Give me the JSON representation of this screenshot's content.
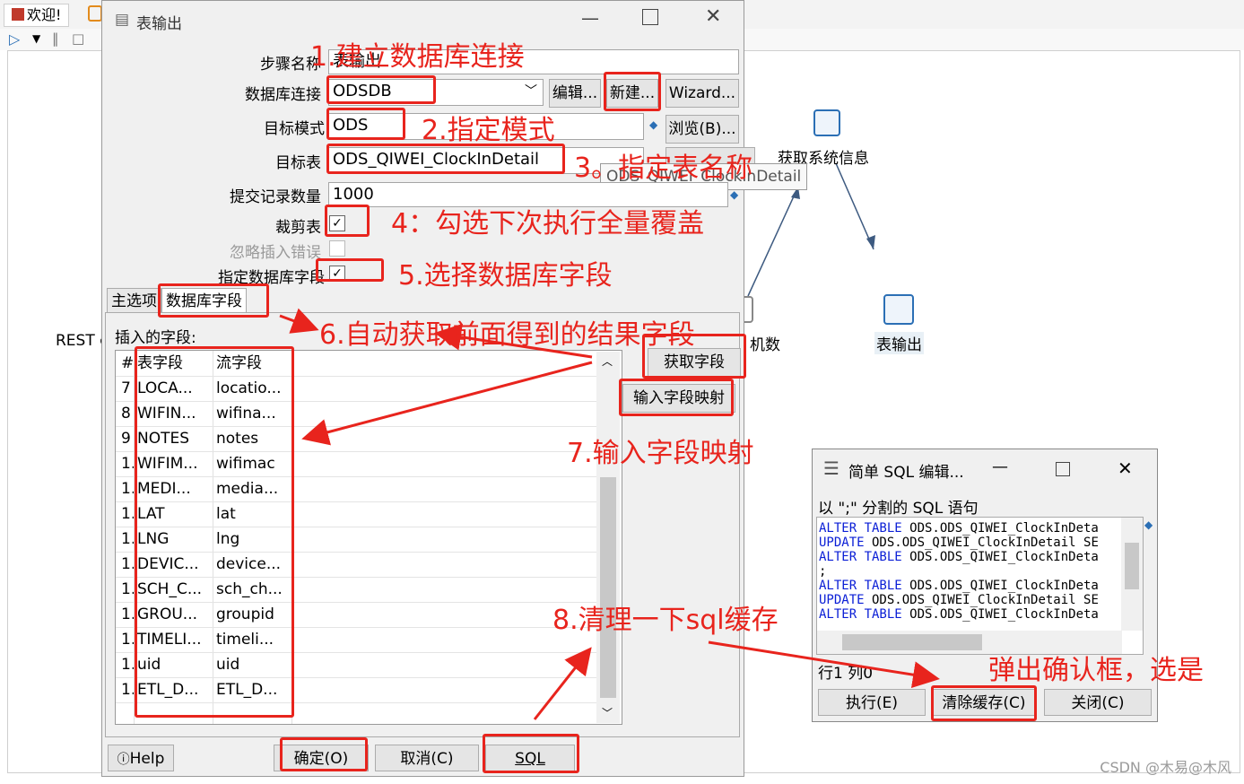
{
  "app": {
    "tab_welcome": "欢迎!",
    "canvas_nodes": {
      "get_system_info": "获取系统信息",
      "table_output": "表输出",
      "rest_partial": "REST c",
      "machine_partial": "机数"
    }
  },
  "dialog": {
    "title": "表输出",
    "step_name_label": "步骤名称",
    "step_name_value": "表输出",
    "db_conn_label": "数据库连接",
    "db_conn_value": "ODSDB",
    "edit_button": "编辑...",
    "new_button": "新建...",
    "wizard_button": "Wizard...",
    "schema_label": "目标模式",
    "schema_value": "ODS",
    "browse_button": "浏览(B)...",
    "target_table_label": "目标表",
    "target_table_value": "ODS_QIWEI_ClockInDetail",
    "tooltip_value": "ODS_QIWEI_ClockInDetail",
    "commit_size_label": "提交记录数量",
    "commit_size_value": "1000",
    "truncate_label": "裁剪表",
    "ignore_errors_label": "忽略插入错误",
    "specify_fields_label": "指定数据库字段",
    "tab_main": "主选项",
    "tab_db_fields": "数据库字段",
    "inserted_fields_label": "插入的字段:",
    "get_fields_button": "获取字段",
    "field_mapping_button": "输入字段映射",
    "help_button": "Help",
    "ok_button": "确定(O)",
    "cancel_button": "取消(C)",
    "sql_button": "SQL"
  },
  "fields_table": {
    "headers": [
      "#",
      "表字段",
      "流字段"
    ],
    "rows": [
      [
        "7",
        "LOCA...",
        "locatio..."
      ],
      [
        "8",
        "WIFIN...",
        "wifina..."
      ],
      [
        "9",
        "NOTES",
        "notes"
      ],
      [
        "1.",
        "WIFIM...",
        "wifimac"
      ],
      [
        "1.",
        "MEDI...",
        "media..."
      ],
      [
        "1.",
        "LAT",
        "lat"
      ],
      [
        "1.",
        "LNG",
        "lng"
      ],
      [
        "1.",
        "DEVIC...",
        "device..."
      ],
      [
        "1.",
        "SCH_C...",
        "sch_ch..."
      ],
      [
        "1.",
        "GROU...",
        "groupid"
      ],
      [
        "1.",
        "TIMELI...",
        "timeli..."
      ],
      [
        "1.",
        "uid",
        "uid"
      ],
      [
        "1.",
        "ETL_D...",
        "ETL_D..."
      ]
    ]
  },
  "sql_dialog": {
    "title": "简单 SQL 编辑...",
    "desc": "以 \";\" 分割的 SQL 语句",
    "lines": [
      {
        "kw": "ALTER TABLE",
        "rest": " ODS.ODS_QIWEI_ClockInDeta"
      },
      {
        "kw": "UPDATE",
        "rest": " ODS.ODS_QIWEI_ClockInDetail SE"
      },
      {
        "kw": "ALTER TABLE",
        "rest": " ODS.ODS_QIWEI_ClockInDeta"
      },
      {
        "kw": "",
        "rest": ";"
      },
      {
        "kw": "ALTER TABLE",
        "rest": " ODS.ODS_QIWEI_ClockInDeta"
      },
      {
        "kw": "UPDATE",
        "rest": " ODS.ODS_QIWEI_ClockInDetail SE"
      },
      {
        "kw": "ALTER TABLE",
        "rest": " ODS.ODS_QIWEI_ClockInDeta"
      }
    ],
    "status": "行1 列0",
    "execute_button": "执行(E)",
    "clear_cache_button": "清除缓存(C)",
    "close_button": "关闭(C)"
  },
  "annotations": {
    "step1": "1.建立数据库连接",
    "step2": "2.指定模式",
    "step3": "3。指定表名称",
    "step4": "4：勾选下次执行全量覆盖",
    "step5": "5.选择数据库字段",
    "step6": "6.自动获取前面得到的结果字段",
    "step7": "7.输入字段映射",
    "step8": "8.清理一下sql缓存",
    "popup": "弹出确认框，选是"
  },
  "watermark": "CSDN @木易@木风",
  "colors": {
    "annotation": "#e8241d",
    "sql_keyword": "#0a1ed6"
  }
}
